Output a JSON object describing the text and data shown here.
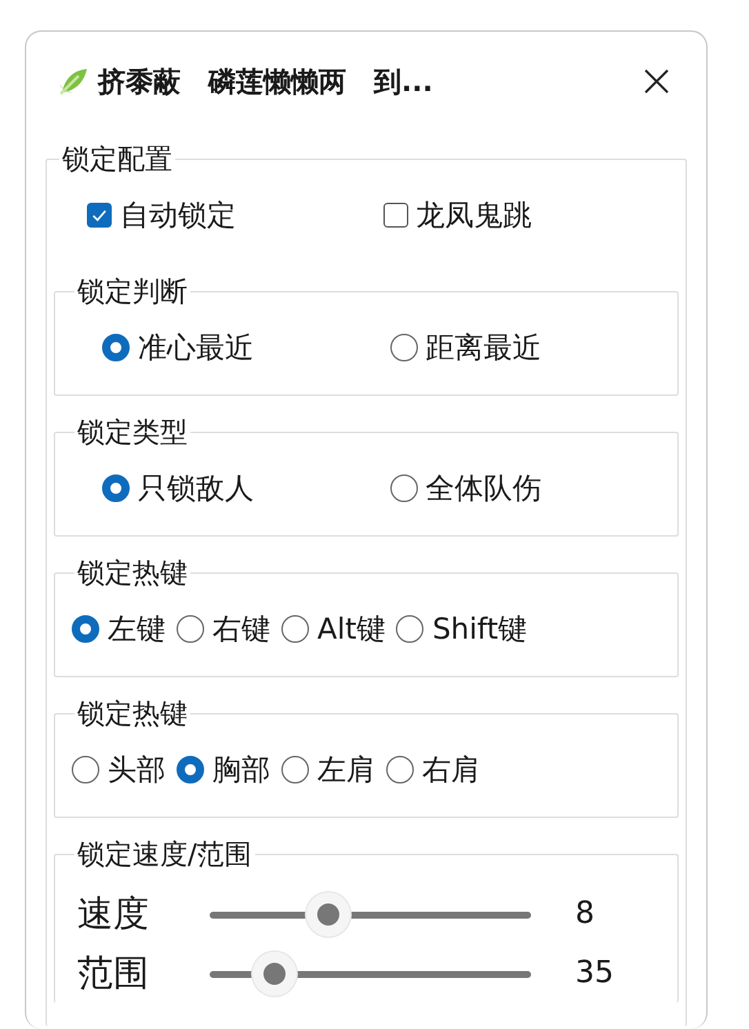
{
  "window": {
    "title": "挤黍蔽　磷莲懒懒两　到..."
  },
  "config": {
    "legend": "锁定配置",
    "checkboxes": [
      {
        "label": "自动锁定",
        "checked": true
      },
      {
        "label": "龙凤鬼跳",
        "checked": false
      }
    ],
    "groups": [
      {
        "kind": "radio",
        "legend": "锁定判断",
        "options": [
          {
            "label": "准心最近",
            "selected": true
          },
          {
            "label": "距离最近",
            "selected": false
          }
        ]
      },
      {
        "kind": "radio",
        "legend": "锁定类型",
        "options": [
          {
            "label": "只锁敌人",
            "selected": true
          },
          {
            "label": "全体队伤",
            "selected": false
          }
        ]
      },
      {
        "kind": "radio",
        "legend": "锁定热键",
        "options": [
          {
            "label": "左键",
            "selected": true
          },
          {
            "label": "右键",
            "selected": false
          },
          {
            "label": "Alt键",
            "selected": false
          },
          {
            "label": "Shift键",
            "selected": false
          }
        ]
      },
      {
        "kind": "radio",
        "legend": "锁定热键",
        "options": [
          {
            "label": "头部",
            "selected": false
          },
          {
            "label": "胸部",
            "selected": true
          },
          {
            "label": "左肩",
            "selected": false
          },
          {
            "label": "右肩",
            "selected": false
          }
        ]
      },
      {
        "kind": "slider",
        "legend": "锁定速度/范围",
        "sliders": [
          {
            "label": "速度",
            "level": 0.37,
            "reading": "8"
          },
          {
            "label": "范围",
            "level": 0.2,
            "reading": "35"
          }
        ]
      }
    ]
  }
}
